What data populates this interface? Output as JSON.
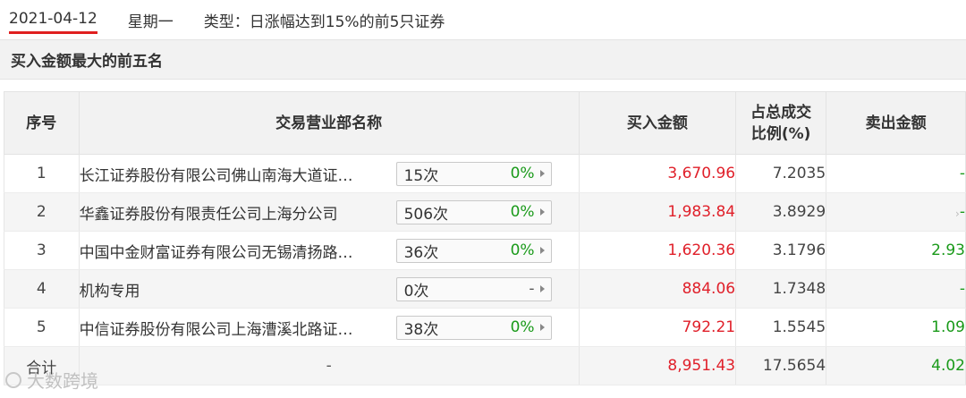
{
  "header": {
    "date": "2021-04-12",
    "weekday": "星期一",
    "type_text": "类型：日涨幅达到15%的前5只证券"
  },
  "section": {
    "title": "买入金额最大的前五名"
  },
  "table": {
    "columns": {
      "seq": "序号",
      "name": "交易营业部名称",
      "buy": "买入金额",
      "ratio_line1": "占总成交",
      "ratio_line2": "比例(%)",
      "sell": "卖出金额"
    },
    "rows": [
      {
        "seq": "1",
        "name": "长江证券股份有限公司佛山南海大道证…",
        "times": "15次",
        "pct": "0%",
        "buy": "3,670.96",
        "ratio": "7.2035",
        "sell": "-"
      },
      {
        "seq": "2",
        "name": "华鑫证券股份有限责任公司上海分公司",
        "times": "506次",
        "pct": "0%",
        "buy": "1,983.84",
        "ratio": "3.8929",
        "sell": "-"
      },
      {
        "seq": "3",
        "name": "中国中金财富证券有限公司无锡清扬路…",
        "times": "36次",
        "pct": "0%",
        "buy": "1,620.36",
        "ratio": "3.1796",
        "sell": "2.93"
      },
      {
        "seq": "4",
        "name": "机构专用",
        "times": "0次",
        "pct": "-",
        "buy": "884.06",
        "ratio": "1.7348",
        "sell": "-"
      },
      {
        "seq": "5",
        "name": "中信证券股份有限公司上海漕溪北路证…",
        "times": "38次",
        "pct": "0%",
        "buy": "792.21",
        "ratio": "1.5545",
        "sell": "1.09"
      }
    ],
    "total": {
      "label": "合计",
      "name": "-",
      "buy": "8,951.43",
      "ratio": "17.5654",
      "sell": "4.02"
    }
  },
  "watermark": {
    "text": "大数跨境"
  },
  "colors": {
    "accent_red": "#e0202a",
    "positive_green": "#1a9a1a",
    "header_bg": "#f2f2f2"
  }
}
